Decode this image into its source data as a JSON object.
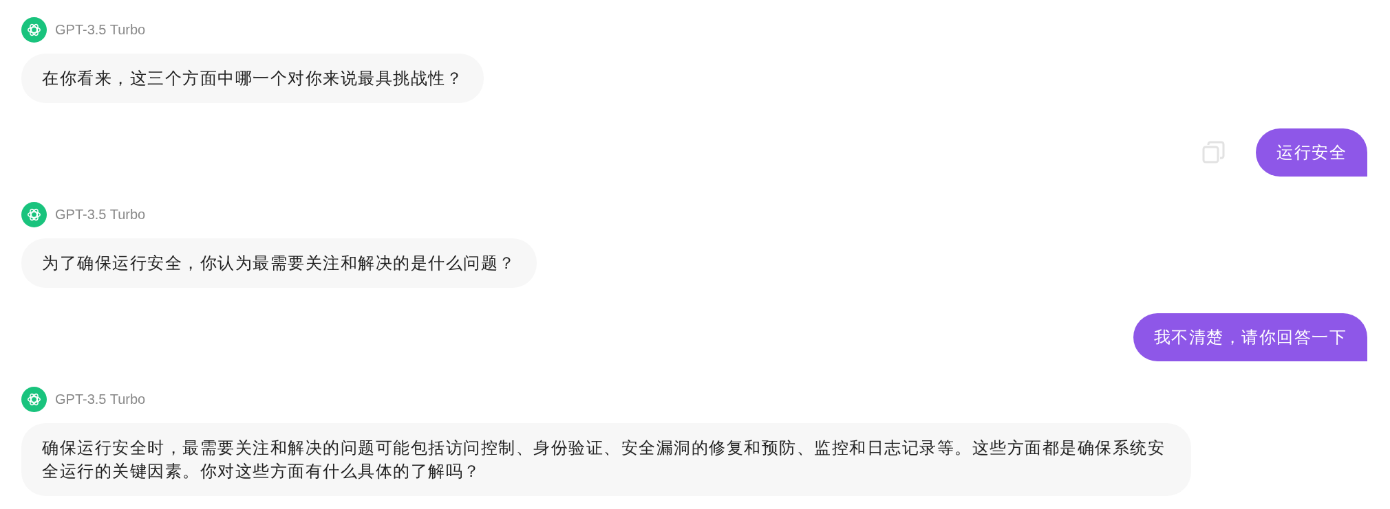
{
  "messages": [
    {
      "kind": "assistant",
      "sender": "GPT-3.5 Turbo",
      "text": "在你看来，这三个方面中哪一个对你来说最具挑战性？"
    },
    {
      "kind": "user",
      "text": "运行安全",
      "copy_icon": true
    },
    {
      "kind": "assistant",
      "sender": "GPT-3.5 Turbo",
      "text": "为了确保运行安全，你认为最需要关注和解决的是什么问题？"
    },
    {
      "kind": "user",
      "text": "我不清楚，请你回答一下",
      "copy_icon": false
    },
    {
      "kind": "assistant",
      "sender": "GPT-3.5 Turbo",
      "text": "确保运行安全时，最需要关注和解决的问题可能包括访问控制、身份验证、安全漏洞的修复和预防、监控和日志记录等。这些方面都是确保系统安全运行的关键因素。你对这些方面有什么具体的了解吗？"
    }
  ]
}
